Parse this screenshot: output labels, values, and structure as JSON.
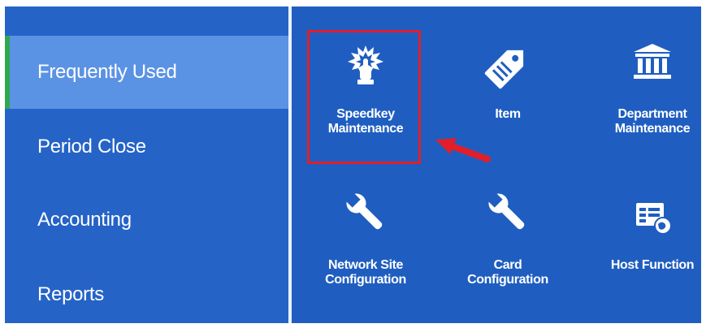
{
  "sidebar": {
    "items": [
      {
        "label": "Frequently Used",
        "active": true
      },
      {
        "label": "Period Close",
        "active": false
      },
      {
        "label": "Accounting",
        "active": false
      },
      {
        "label": "Reports",
        "active": false
      }
    ]
  },
  "tiles": [
    {
      "lines": [
        "Speedkey",
        "Maintenance"
      ],
      "icon": "speedkey-icon",
      "highlighted": true
    },
    {
      "lines": [
        "Item"
      ],
      "icon": "tag-icon"
    },
    {
      "lines": [
        "Department",
        "Maintenance"
      ],
      "icon": "building-icon"
    },
    {
      "lines": [
        "Network Site",
        "Configuration"
      ],
      "icon": "wrench-icon"
    },
    {
      "lines": [
        "Card",
        "Configuration"
      ],
      "icon": "wrench-icon"
    },
    {
      "lines": [
        "Host Function"
      ],
      "icon": "host-function-icon"
    }
  ],
  "colors": {
    "background": "#1f5ec0",
    "sidebar_active": "#5b93e4",
    "active_indicator": "#2fa84f",
    "highlight": "#e01f2a"
  }
}
